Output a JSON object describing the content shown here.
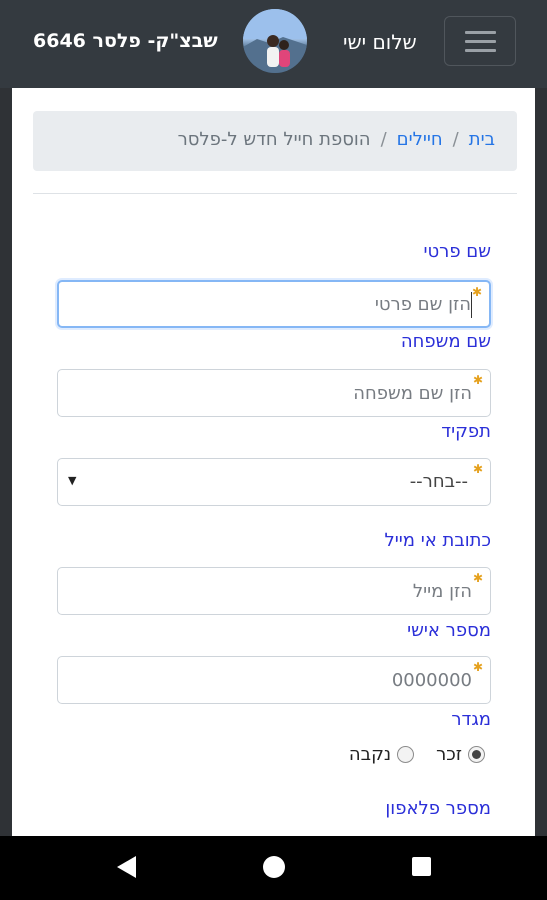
{
  "header": {
    "unit_title": "שבצ\"ק- פלסר 6646",
    "greeting": "שלום ישי",
    "menu_icon": "hamburger-icon"
  },
  "breadcrumb": {
    "home": "בית",
    "soldiers": "חיילים",
    "current": "הוספת חייל חדש ל-פלסר",
    "separator": "/"
  },
  "form": {
    "first_name": {
      "label": "שם פרטי",
      "placeholder": "הזן שם פרטי",
      "required_mark": "✱"
    },
    "last_name": {
      "label": "שם משפחה",
      "placeholder": "הזן שם משפחה",
      "required_mark": "✱"
    },
    "role": {
      "label": "תפקיד",
      "selected": "--בחר--",
      "required_mark": "✱"
    },
    "email": {
      "label": "כתובת אי מייל",
      "placeholder": "הזן מייל",
      "required_mark": "✱"
    },
    "personal_number": {
      "label": "מספר אישי",
      "placeholder": "0000000",
      "required_mark": "✱"
    },
    "gender": {
      "label": "מגדר",
      "male": "זכר",
      "female": "נקבה",
      "selected": "male"
    },
    "phone": {
      "label": "מספר פלאפון"
    }
  },
  "system_nav": {
    "back": "back-icon",
    "home": "home-icon",
    "recents": "recents-icon"
  },
  "colors": {
    "topbar": "#343a40",
    "link": "#2575e6",
    "label": "#2b2fd8",
    "required": "#e5a11e"
  }
}
